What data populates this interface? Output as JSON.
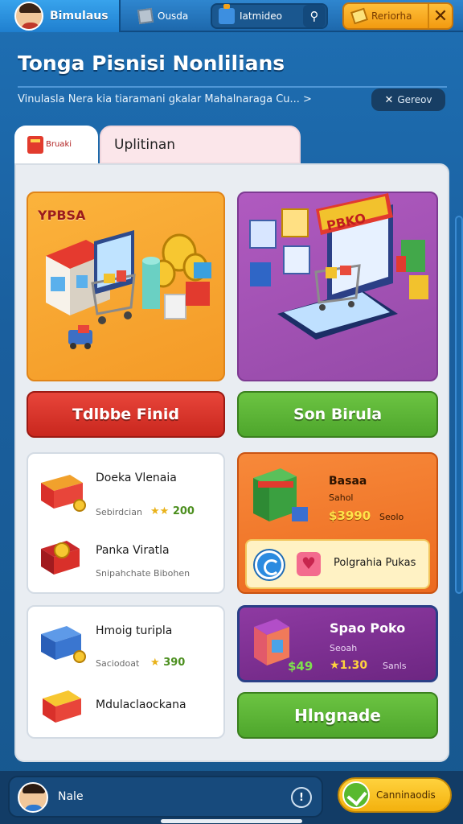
{
  "topbar": {
    "brand_label": "Bimulaus",
    "box_label": "Ousda",
    "search_label": "Iatmideo",
    "offer_label": "Reriorha"
  },
  "header": {
    "title": "Tonga Pisnisi Nonlilians",
    "subtitle": "Vinulasla Nera kia tiaramani gkalar Mahalnaraga Cu... >",
    "generate_label": "Gereov"
  },
  "tabs": [
    {
      "label": "Bruaki"
    },
    {
      "label": "Uplitinan"
    }
  ],
  "heroes": {
    "market_label": "YPBSA",
    "online_sign": "PBKO"
  },
  "actions": {
    "left_button": "Tdlbbe Finid",
    "right_button": "Son Birula",
    "upgrade_button": "Hlngnade"
  },
  "left_list_1": [
    {
      "title": "Doeka Vlenaia",
      "sub": "Sebirdcian",
      "price": "200"
    },
    {
      "title": "Panka Viratla",
      "sub": "Snipahchate Bibohen"
    }
  ],
  "left_list_2": [
    {
      "title": "Hmoig turipla",
      "sub": "Saciodoat",
      "price": "390"
    },
    {
      "title": "Mdulaclaockana"
    }
  ],
  "orange_card": {
    "title": "Basaa",
    "sub": "Sahol",
    "price": "$3990",
    "price_label": "Seolo",
    "promo_label": "Polgrahia Pukas"
  },
  "purple_card": {
    "title": "Spao Poko",
    "sub": "Seoah",
    "price_alt": "$49",
    "price": "1.30",
    "price_label": "Sanls"
  },
  "bottombar": {
    "user_name": "Nale",
    "info_label": "!",
    "continue_label": "Canninaodis"
  },
  "colors": {
    "background": "#1e6fb3",
    "red_button": "#e8453a",
    "green_button": "#6cc442",
    "orange_card": "#f7893a",
    "purple_card": "#8e3aa2",
    "gold": "#ffd23d"
  }
}
